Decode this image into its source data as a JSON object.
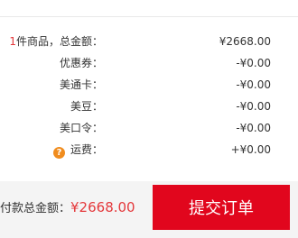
{
  "summary": {
    "items": {
      "count": "1",
      "label_rest": "件商品，总金额：",
      "value": "¥2668.00"
    },
    "discount": {
      "label": "优惠券：",
      "value": "-¥0.00"
    },
    "card": {
      "label": "美通卡：",
      "value": "-¥0.00"
    },
    "beans": {
      "label": "美豆：",
      "value": "-¥0.00"
    },
    "code": {
      "label": "美口令：",
      "value": "-¥0.00"
    },
    "shipping": {
      "label": "运费：",
      "value": "+¥0.00",
      "help_icon_glyph": "?"
    }
  },
  "footer": {
    "total_label": "付款总金额：",
    "total_amount": "¥2668.00",
    "submit_label": "提交订单"
  },
  "colors": {
    "accent": "#e1061d",
    "price_red": "#e4393c",
    "help_icon": "#f08c1e"
  }
}
